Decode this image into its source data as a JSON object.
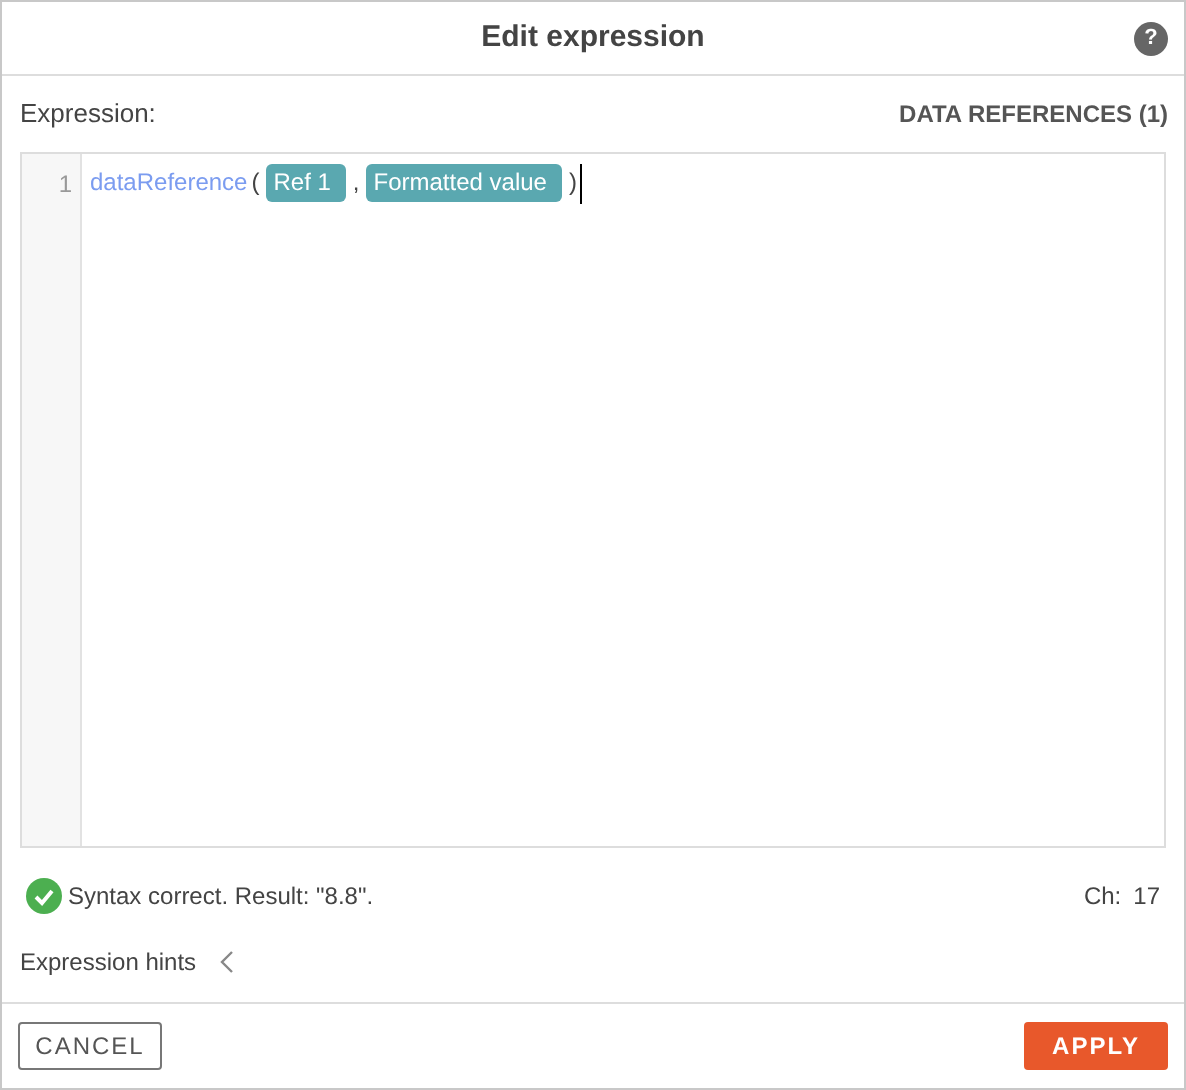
{
  "dialog": {
    "title": "Edit expression",
    "help": "?"
  },
  "expression_label": "Expression:",
  "data_references_link": "DATA REFERENCES (1)",
  "editor": {
    "line_number": "1",
    "tokens": [
      {
        "kind": "function",
        "text": "dataReference"
      },
      {
        "kind": "punct",
        "text": "("
      },
      {
        "kind": "reference",
        "text": "Ref 1"
      },
      {
        "kind": "punct",
        "text": ","
      },
      {
        "kind": "reference",
        "text": "Formatted value"
      },
      {
        "kind": "punct",
        "text": ")"
      }
    ]
  },
  "status": {
    "kind": "ok",
    "message": "Syntax correct. Result: \"8.8\".",
    "char_label": "Ch:",
    "char_count": "17"
  },
  "hints": {
    "label": "Expression hints",
    "expanded": false
  },
  "buttons": {
    "cancel": "CANCEL",
    "apply": "APPLY"
  }
}
